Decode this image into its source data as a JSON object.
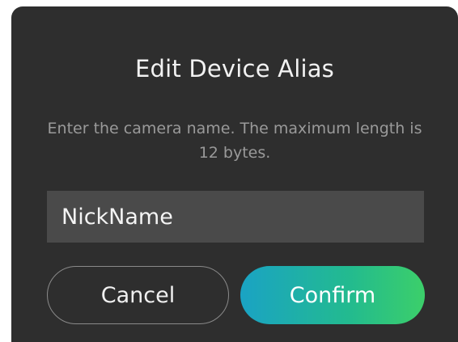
{
  "dialog": {
    "title": "Edit Device Alias",
    "message": "Enter the camera name. The maximum length is 12 bytes.",
    "input": {
      "value": "NickName"
    },
    "cancel_label": "Cancel",
    "confirm_label": "Confirm"
  },
  "colors": {
    "dialog_background": "#2e2e2e",
    "input_background": "#4a4a4a",
    "confirm_gradient_start": "#1aa3c4",
    "confirm_gradient_end": "#3ccf6a"
  }
}
